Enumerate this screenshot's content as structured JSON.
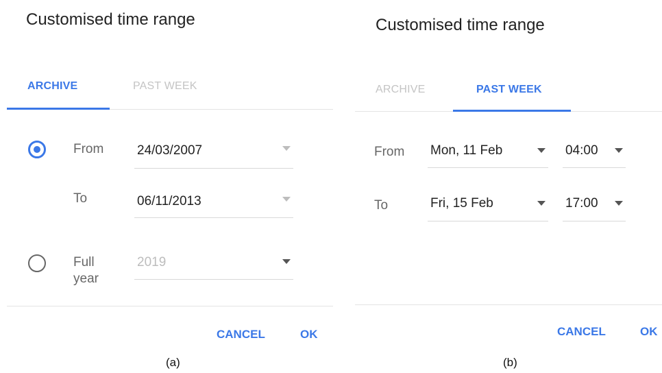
{
  "panel_a": {
    "title": "Customised time range",
    "tabs": [
      {
        "label": "ARCHIVE",
        "active": true
      },
      {
        "label": "PAST WEEK",
        "active": false
      }
    ],
    "range_option": {
      "selected": true,
      "from_label": "From",
      "from_value": "24/03/2007",
      "to_label": "To",
      "to_value": "06/11/2013"
    },
    "full_year_option": {
      "selected": false,
      "label_line1": "Full",
      "label_line2": "year",
      "value": "2019"
    },
    "cancel_label": "CANCEL",
    "ok_label": "OK",
    "caption": "(a)"
  },
  "panel_b": {
    "title": "Customised time range",
    "tabs": [
      {
        "label": "ARCHIVE",
        "active": false
      },
      {
        "label": "PAST WEEK",
        "active": true
      }
    ],
    "from_label": "From",
    "from_date": "Mon, 11 Feb",
    "from_time": "04:00",
    "to_label": "To",
    "to_date": "Fri, 15 Feb",
    "to_time": "17:00",
    "cancel_label": "CANCEL",
    "ok_label": "OK",
    "caption": "(b)"
  },
  "colors": {
    "accent": "#3b78e7",
    "inactive_tab": "#c4c4c4",
    "divider": "#e4e4e4"
  },
  "icons": [
    "dropdown-caret-icon",
    "radio-selected-icon",
    "radio-unselected-icon"
  ]
}
